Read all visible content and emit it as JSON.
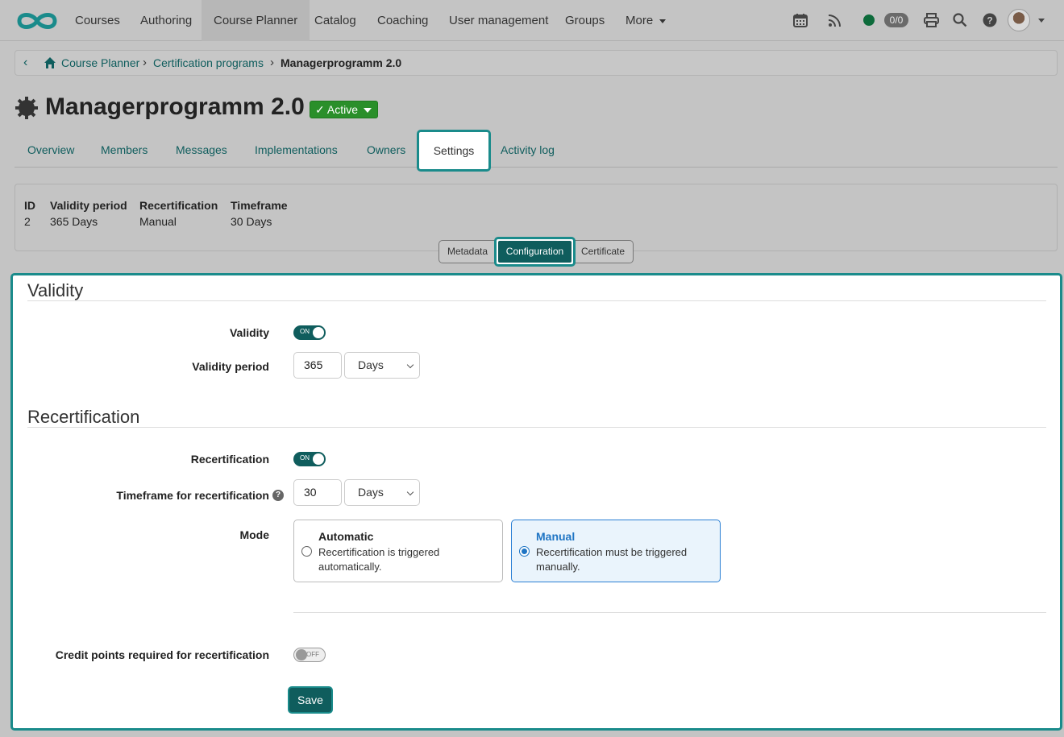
{
  "nav": {
    "items": [
      "Courses",
      "Authoring",
      "Course Planner",
      "Catalog",
      "Coaching",
      "User management",
      "Groups",
      "More"
    ],
    "active": "Course Planner",
    "count_badge": "0/0",
    "icons": [
      "calendar-icon",
      "rss-icon",
      "status-dot-icon",
      "print-icon",
      "search-icon",
      "help-icon",
      "avatar",
      "chevron-down-icon"
    ]
  },
  "breadcrumb": {
    "items": [
      "Course Planner",
      "Certification programs"
    ],
    "current": "Managerprogramm 2.0"
  },
  "header": {
    "title": "Managerprogramm 2.0",
    "status": "Active"
  },
  "tabs": [
    "Overview",
    "Members",
    "Messages",
    "Implementations",
    "Owners",
    "Settings",
    "Activity log"
  ],
  "active_tab": "Settings",
  "summary": {
    "headers": [
      "ID",
      "Validity period",
      "Recertification",
      "Timeframe"
    ],
    "values": [
      "2",
      "365 Days",
      "Manual",
      "30 Days"
    ]
  },
  "subtabs": {
    "items": [
      "Metadata",
      "Configuration",
      "Certificate"
    ],
    "active": "Configuration"
  },
  "validity": {
    "section_title": "Validity",
    "validity_label": "Validity",
    "validity_toggle": "ON",
    "period_label": "Validity period",
    "period_value": "365",
    "period_unit": "Days"
  },
  "recertification": {
    "section_title": "Recertification",
    "recert_label": "Recertification",
    "recert_toggle": "ON",
    "timeframe_label": "Timeframe for recertification",
    "timeframe_value": "30",
    "timeframe_unit": "Days",
    "mode_label": "Mode",
    "modes": [
      {
        "title": "Automatic",
        "desc": "Recertification is triggered automatically.",
        "selected": false
      },
      {
        "title": "Manual",
        "desc": "Recertification must be triggered manually.",
        "selected": true
      }
    ],
    "credit_label": "Credit points required for recertification",
    "credit_toggle": "OFF"
  },
  "save_label": "Save",
  "colors": {
    "primary": "#0f5d5d",
    "accent_border": "#1a8b8b",
    "active_status": "#2a8f2a",
    "selected_card": "#1f75c4"
  }
}
